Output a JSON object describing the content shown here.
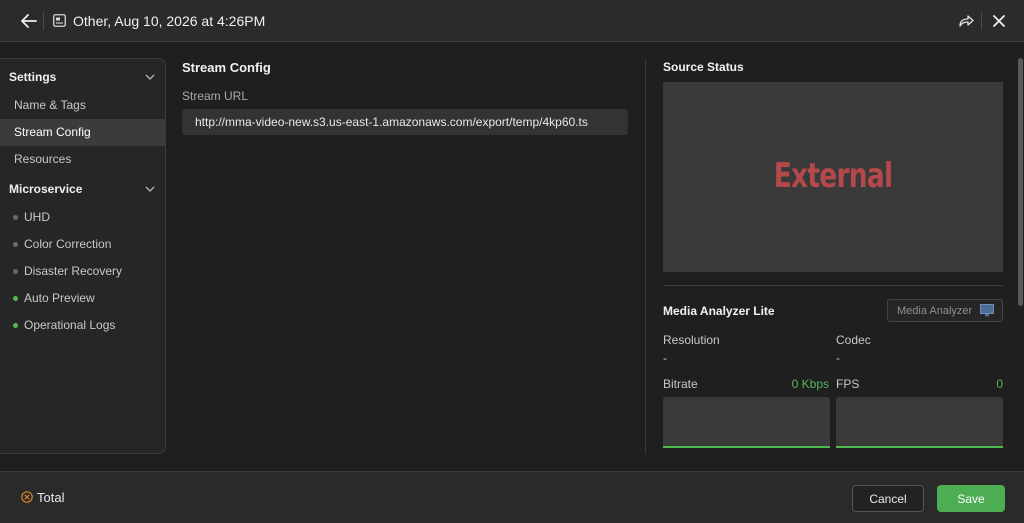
{
  "header": {
    "title": "Other, Aug 10, 2026 at 4:26PM",
    "icons": [
      "back-arrow-icon",
      "document-icon",
      "share-icon",
      "close-icon"
    ]
  },
  "sidebar": {
    "sections": [
      {
        "title": "Settings",
        "items": [
          "Name & Tags",
          "Stream Config",
          "Resources"
        ],
        "active": "Stream Config"
      },
      {
        "title": "Microservice",
        "items": [
          {
            "label": "UHD",
            "status": "inactive"
          },
          {
            "label": "Color Correction",
            "status": "inactive"
          },
          {
            "label": "Disaster Recovery",
            "status": "inactive"
          },
          {
            "label": "Auto Preview",
            "status": "active"
          },
          {
            "label": "Operational Logs",
            "status": "active"
          }
        ]
      }
    ]
  },
  "main": {
    "title": "Stream Config",
    "url_label": "Stream URL",
    "url_value": "http://mma-video-new.s3.us-east-1.amazonaws.com/export/temp/4kp60.ts"
  },
  "source": {
    "title": "Source Status",
    "preview_text": "External"
  },
  "analyzer": {
    "title": "Media Analyzer Lite",
    "button_label": "Media Analyzer",
    "resolution_label": "Resolution",
    "resolution_value": "-",
    "codec_label": "Codec",
    "codec_value": "-",
    "bitrate_label": "Bitrate",
    "bitrate_value": "0 Kbps",
    "fps_label": "FPS",
    "fps_value": "0"
  },
  "footer": {
    "total_label": "Total",
    "cancel_label": "Cancel",
    "save_label": "Save"
  },
  "colors": {
    "accent_green": "#4cad53",
    "status_green": "#59b45c",
    "inactive_dot": "#6a6a6a",
    "preview_text": "#b5484a",
    "total_icon": "#d9822b"
  }
}
